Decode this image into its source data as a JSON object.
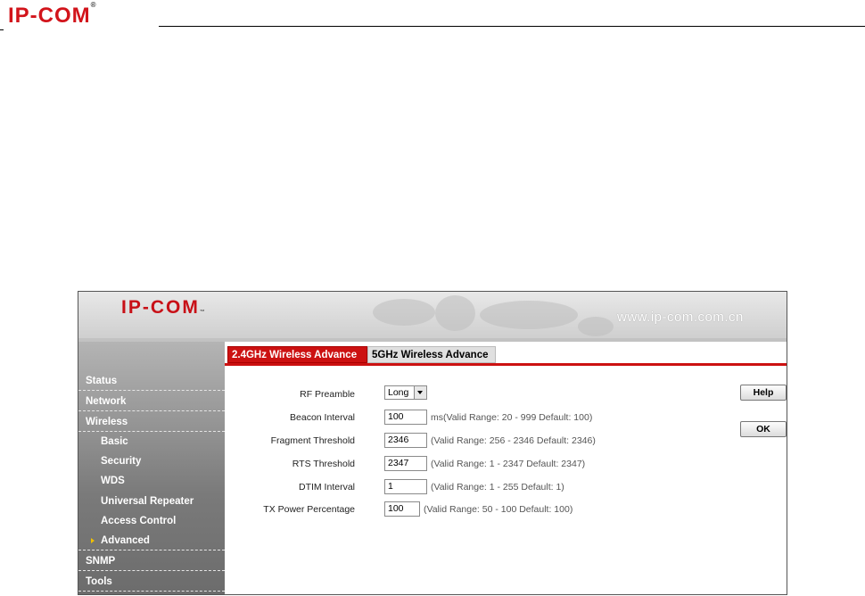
{
  "document": {
    "logo": "IP-COM",
    "logo_mark": "®"
  },
  "banner": {
    "logo": "IP-COM",
    "logo_mark": "™",
    "url": "www.ip-com.com.cn"
  },
  "sidebar": {
    "items": [
      {
        "label": "Status",
        "level": "top"
      },
      {
        "label": "Network",
        "level": "top"
      },
      {
        "label": "Wireless",
        "level": "top"
      },
      {
        "label": "Basic",
        "level": "sub"
      },
      {
        "label": "Security",
        "level": "sub"
      },
      {
        "label": "WDS",
        "level": "sub"
      },
      {
        "label": "Universal Repeater",
        "level": "sub"
      },
      {
        "label": "Access Control",
        "level": "sub"
      },
      {
        "label": "Advanced",
        "level": "sub",
        "selected": true
      },
      {
        "label": "SNMP",
        "level": "top"
      },
      {
        "label": "Tools",
        "level": "top"
      }
    ]
  },
  "tabs": [
    {
      "label": "2.4GHz Wireless Advance",
      "active": true
    },
    {
      "label": "5GHz Wireless Advance",
      "active": false
    }
  ],
  "form": {
    "rf_preamble": {
      "label": "RF Preamble",
      "value": "Long"
    },
    "beacon_interval": {
      "label": "Beacon Interval",
      "value": "100",
      "hint": "ms(Valid Range: 20 - 999 Default: 100)"
    },
    "fragment_threshold": {
      "label": "Fragment Threshold",
      "value": "2346",
      "hint": "(Valid Range: 256 - 2346 Default: 2346)"
    },
    "rts_threshold": {
      "label": "RTS Threshold",
      "value": "2347",
      "hint": "(Valid Range: 1 - 2347 Default: 2347)"
    },
    "dtim_interval": {
      "label": "DTIM Interval",
      "value": "1",
      "hint": "(Valid Range: 1 - 255 Default: 1)"
    },
    "tx_power": {
      "label": "TX Power Percentage",
      "value": "100",
      "hint": "(Valid Range: 50 - 100 Default: 100)"
    }
  },
  "buttons": {
    "help": "Help",
    "ok": "OK"
  },
  "colors": {
    "brand_red": "#cc1111",
    "nav_gray": "#7a7a7a",
    "selected_arrow": "#f0c000"
  }
}
